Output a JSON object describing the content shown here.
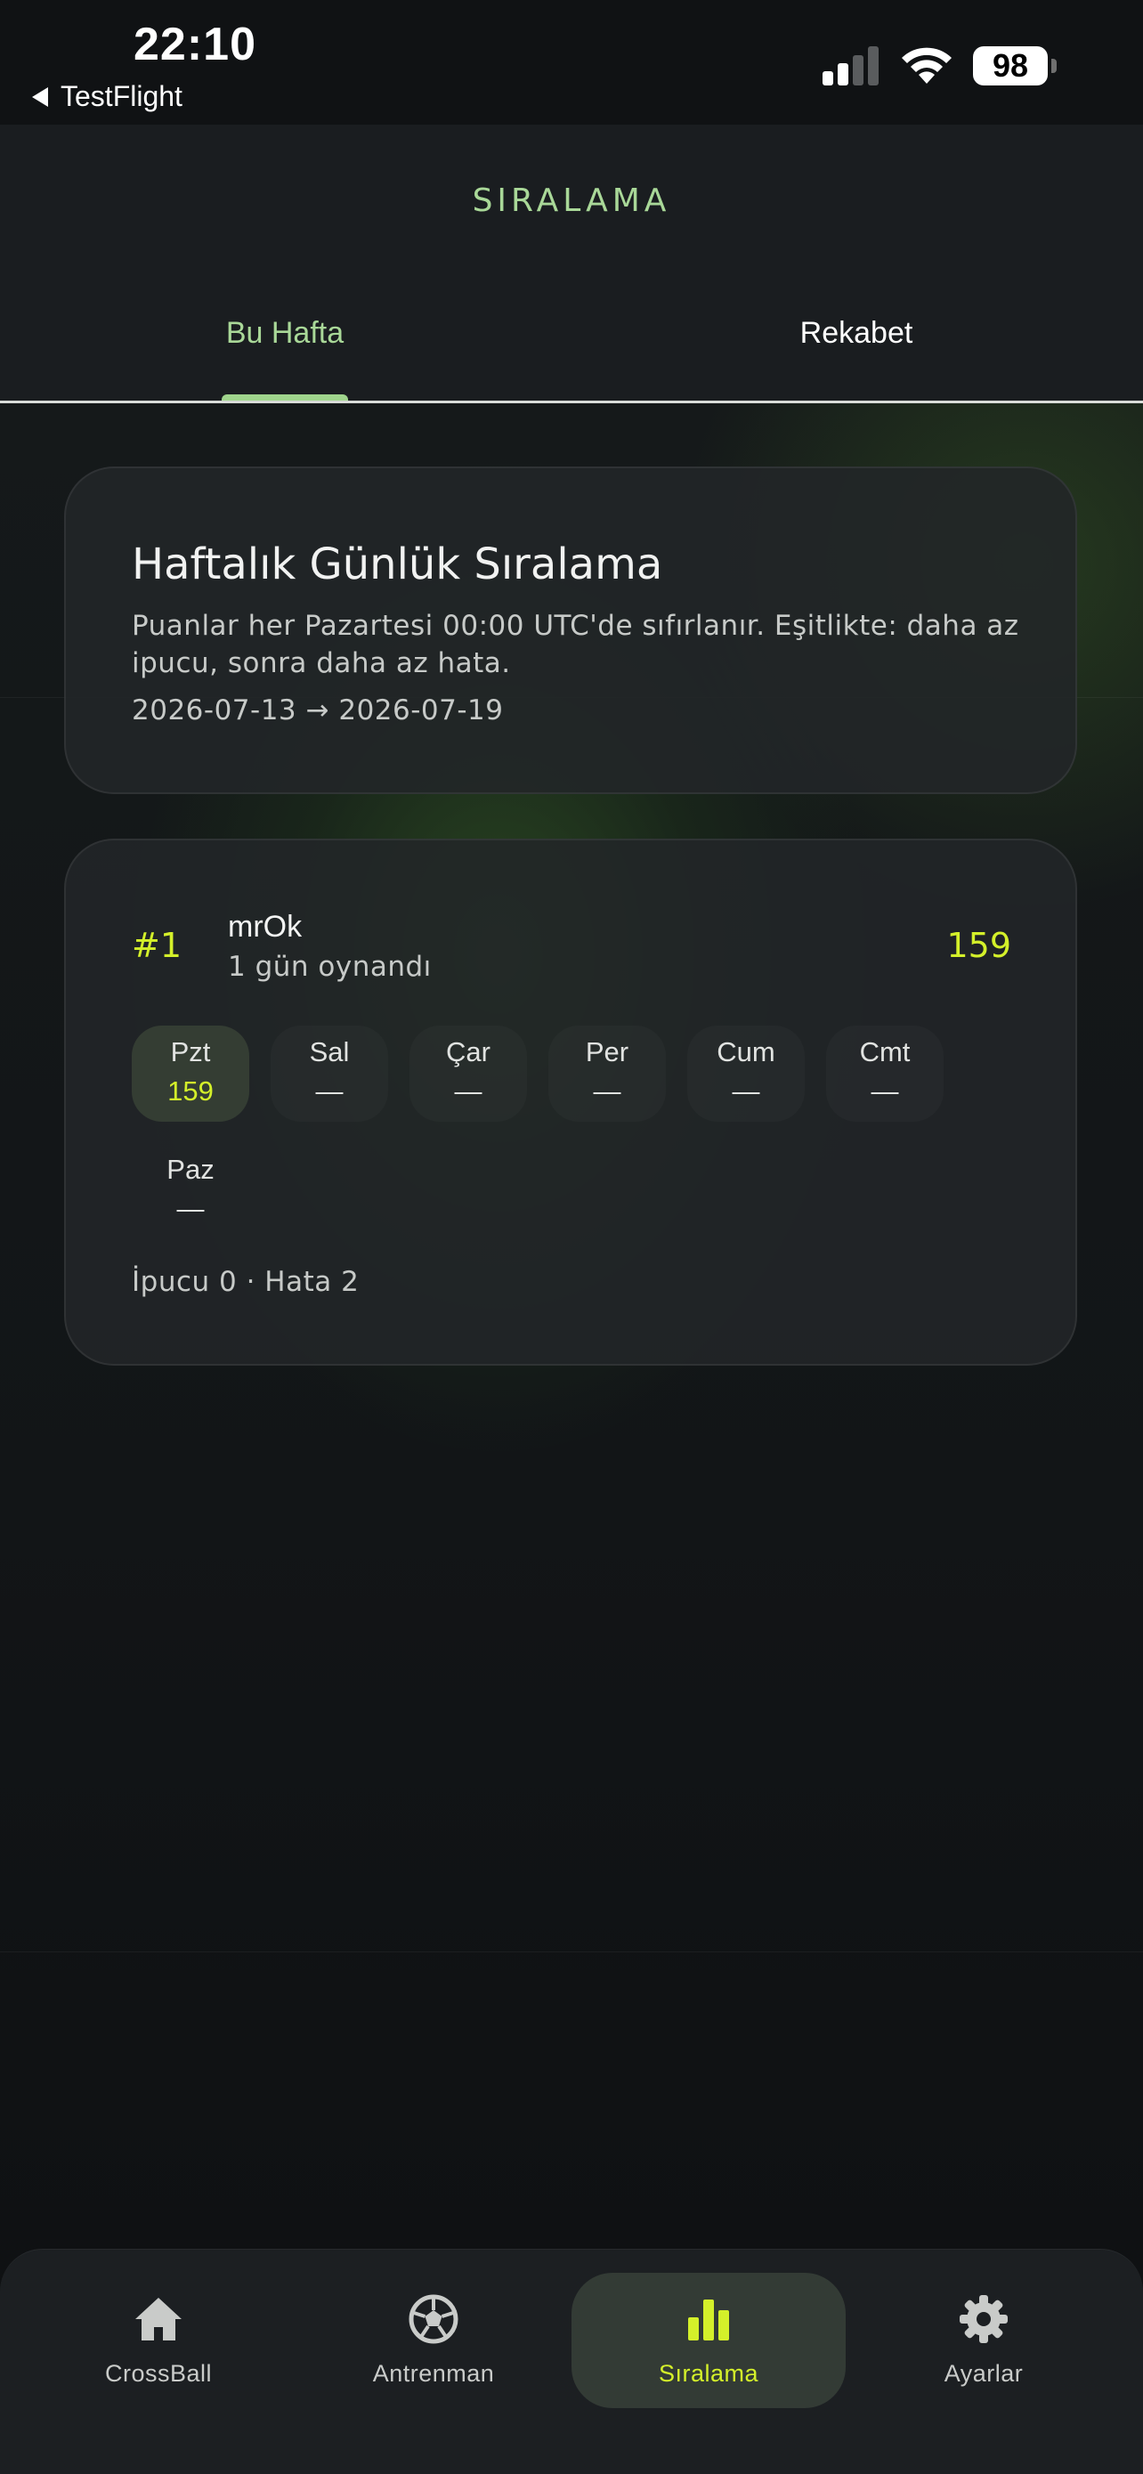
{
  "status_bar": {
    "time": "22:10",
    "back_app": "TestFlight",
    "battery": "98"
  },
  "header": {
    "title": "SIRALAMA",
    "tabs": [
      {
        "label": "Bu Hafta",
        "active": true
      },
      {
        "label": "Rekabet",
        "active": false
      }
    ]
  },
  "info_card": {
    "title": "Haftalık Günlük Sıralama",
    "description": "Puanlar her Pazartesi 00:00 UTC'de sıfırlanır. Eşitlikte: daha az ipucu, sonra daha az hata.",
    "date_range": "2026-07-13 → 2026-07-19"
  },
  "leaderboard": {
    "entries": [
      {
        "rank": "#1",
        "name": "mrOk",
        "played": "1 gün oynandı",
        "score": "159",
        "days": [
          {
            "label": "Pzt",
            "value": "159",
            "active": true
          },
          {
            "label": "Sal",
            "value": "—",
            "active": false
          },
          {
            "label": "Çar",
            "value": "—",
            "active": false
          },
          {
            "label": "Per",
            "value": "—",
            "active": false
          },
          {
            "label": "Cum",
            "value": "—",
            "active": false
          },
          {
            "label": "Cmt",
            "value": "—",
            "active": false
          },
          {
            "label": "Paz",
            "value": "—",
            "active": false
          }
        ],
        "stats": "İpucu 0 · Hata 2"
      }
    ]
  },
  "tab_bar": {
    "items": [
      {
        "label": "CrossBall",
        "icon": "home-icon",
        "active": false
      },
      {
        "label": "Antrenman",
        "icon": "soccer-ball-icon",
        "active": false
      },
      {
        "label": "Sıralama",
        "icon": "bar-chart-icon",
        "active": true
      },
      {
        "label": "Ayarlar",
        "icon": "gear-icon",
        "active": false
      }
    ]
  },
  "colors": {
    "accent_green": "#a9d898",
    "highlight_lime": "#d4f02a",
    "background": "#0f1113",
    "card": "#222628"
  }
}
